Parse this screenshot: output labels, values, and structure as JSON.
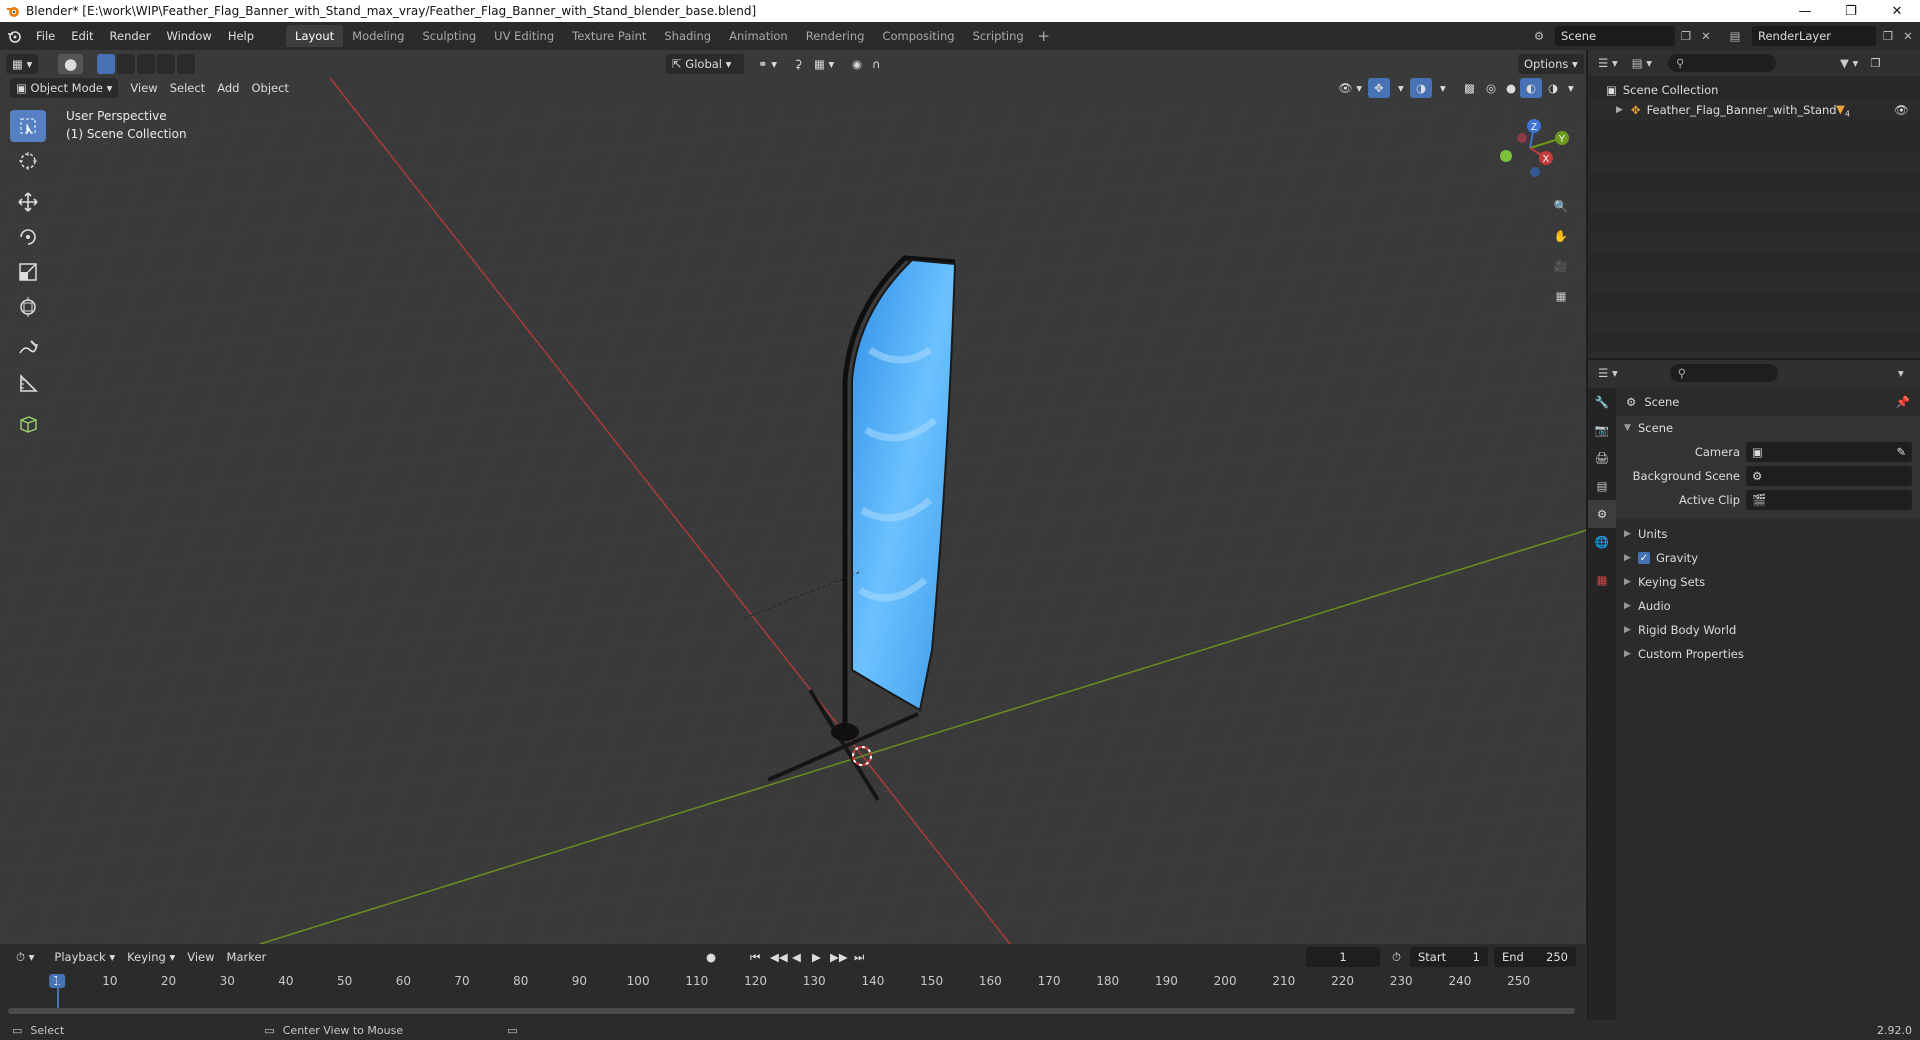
{
  "window": {
    "title": "Blender* [E:\\work\\WIP\\Feather_Flag_Banner_with_Stand_max_vray/Feather_Flag_Banner_with_Stand_blender_base.blend]"
  },
  "menu": [
    "File",
    "Edit",
    "Render",
    "Window",
    "Help"
  ],
  "workspaces": [
    "Layout",
    "Modeling",
    "Sculpting",
    "UV Editing",
    "Texture Paint",
    "Shading",
    "Animation",
    "Rendering",
    "Compositing",
    "Scripting"
  ],
  "scene_name": "Scene",
  "render_layer": "RenderLayer",
  "viewport": {
    "mode": "Object Mode",
    "menus": [
      "View",
      "Select",
      "Add",
      "Object"
    ],
    "orientation": "Global",
    "options_label": "Options",
    "perspective": "User Perspective",
    "collection": "(1) Scene Collection",
    "axes": {
      "x": "X",
      "y": "Y",
      "z": "Z"
    }
  },
  "outliner": {
    "root": "Scene Collection",
    "items": [
      {
        "label": "Feather_Flag_Banner_with_Stand",
        "badge": "4"
      }
    ]
  },
  "properties": {
    "context": "Scene",
    "panel": "Scene",
    "fields": [
      {
        "label": "Camera",
        "value": ""
      },
      {
        "label": "Background Scene",
        "value": ""
      },
      {
        "label": "Active Clip",
        "value": ""
      }
    ],
    "subpanels": [
      {
        "label": "Units",
        "checkbox": false
      },
      {
        "label": "Gravity",
        "checkbox": true
      },
      {
        "label": "Keying Sets",
        "checkbox": false
      },
      {
        "label": "Audio",
        "checkbox": false
      },
      {
        "label": "Rigid Body World",
        "checkbox": false
      },
      {
        "label": "Custom Properties",
        "checkbox": false
      }
    ]
  },
  "timeline": {
    "menus": [
      "Playback",
      "Keying",
      "View",
      "Marker"
    ],
    "current_frame": "1",
    "start_label": "Start",
    "start": "1",
    "end_label": "End",
    "end": "250",
    "ticks": [
      "1",
      "10",
      "20",
      "30",
      "40",
      "50",
      "60",
      "70",
      "80",
      "90",
      "100",
      "110",
      "120",
      "130",
      "140",
      "150",
      "160",
      "170",
      "180",
      "190",
      "200",
      "210",
      "220",
      "230",
      "240",
      "250"
    ]
  },
  "statusbar": {
    "left": "Select",
    "middle": "Center View to Mouse",
    "version": "2.92.0"
  },
  "colors": {
    "accent": "#4772b3",
    "x_axis": "#c23b3b",
    "y_axis": "#6c9a1f",
    "z_axis": "#3f74d4",
    "flag": "#4aa8f0"
  }
}
